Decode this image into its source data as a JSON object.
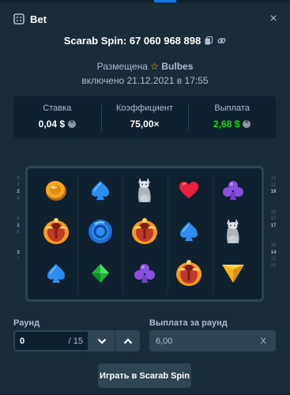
{
  "header": {
    "title": "Bet",
    "close_label": "×"
  },
  "game": {
    "name_id": "Scarab Spin: 67 060 968 898"
  },
  "placed": {
    "prefix": "Размещена",
    "user": "Bulbes"
  },
  "date": "включено 21.12.2021 в 17:55",
  "stats": {
    "bet": {
      "label": "Ставка",
      "value": "0,04 $"
    },
    "multiplier": {
      "label": "Коэффициент",
      "value": "75,00×"
    },
    "payout": {
      "label": "Выплата",
      "value": "2,68 $"
    }
  },
  "paylines": {
    "left": [
      "9",
      "7",
      "2",
      "6",
      "",
      "",
      "8",
      "1",
      "5",
      "",
      "",
      "3",
      "7",
      ""
    ],
    "right": [
      "13",
      "11",
      "19",
      "",
      "",
      "16",
      "10",
      "17",
      "",
      "",
      "18",
      "14",
      "12",
      "20"
    ]
  },
  "reels": [
    [
      "gold-coin-icon",
      "scarab-icon",
      "blue-spade-icon"
    ],
    [
      "blue-spade-icon",
      "blue-ring-icon",
      "green-diamond-icon"
    ],
    [
      "cat-statue-icon",
      "scarab-icon",
      "purple-club-icon"
    ],
    [
      "red-heart-icon",
      "blue-spade-icon",
      "scarab-icon"
    ],
    [
      "purple-club-icon",
      "cat-statue-icon",
      "yellow-triangle-icon"
    ]
  ],
  "colors": {
    "accent_green": "#00e701",
    "panel": "#0f212e",
    "bg": "#1a2c38"
  },
  "controls": {
    "round_label": "Раунд",
    "round_value": "0",
    "round_total": "/ 15",
    "payout_label": "Выплата за раунд",
    "payout_value": "6,00",
    "payout_clear": "X",
    "play_button": "Играть в Scarab Spin"
  }
}
